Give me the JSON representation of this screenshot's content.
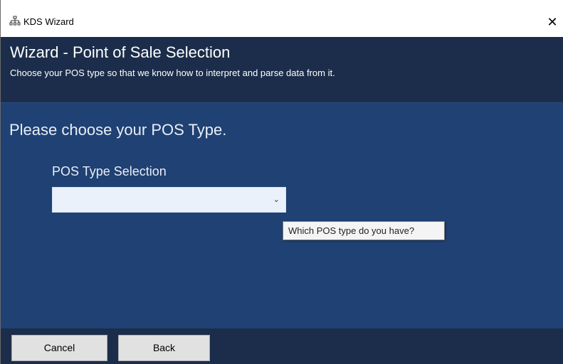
{
  "window": {
    "title": "KDS Wizard",
    "app_icon": "network-icon",
    "close_icon": "close-icon",
    "close_glyph": "✕"
  },
  "header": {
    "title": "Wizard - Point of Sale Selection",
    "subtitle": "Choose your POS type so that we know how to interpret and parse data from it."
  },
  "content": {
    "heading": "Please choose your POS Type.",
    "field_label": "POS Type Selection",
    "select": {
      "value": "",
      "chevron_icon": "chevron-down-icon",
      "chevron_glyph": "⌄"
    },
    "tooltip": "Which POS type do you have?"
  },
  "footer": {
    "cancel_label": "Cancel",
    "back_label": "Back"
  },
  "colors": {
    "header_bg": "#1b2d4a",
    "content_bg": "#1f4173",
    "button_bg": "#e1e1e1",
    "select_bg": "#eaf1fb"
  }
}
